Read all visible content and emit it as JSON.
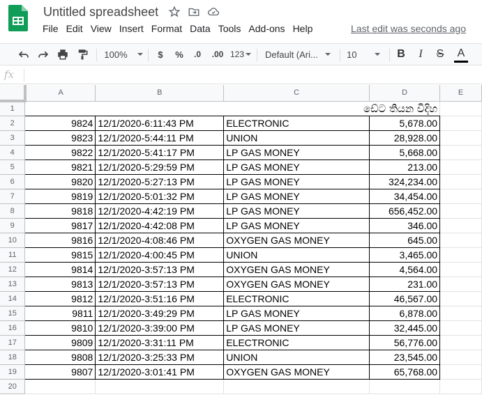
{
  "app": {
    "title": "Untitled spreadsheet",
    "last_edit": "Last edit was seconds ago",
    "brand_color": "#0F9D58"
  },
  "menu": [
    "File",
    "Edit",
    "View",
    "Insert",
    "Format",
    "Data",
    "Tools",
    "Add-ons",
    "Help"
  ],
  "toolbar": {
    "zoom": "100%",
    "currency": "$",
    "percent": "%",
    "decrease_decimal": ".0",
    "increase_decimal": ".00",
    "more_formats": "123",
    "font": "Default (Ari...",
    "font_size": "10",
    "bold": "B",
    "italic": "I",
    "strike": "S",
    "text_color": "A"
  },
  "formula_bar": {
    "fx": "fx",
    "value": ""
  },
  "columns": [
    "A",
    "B",
    "C",
    "D",
    "E"
  ],
  "sheet": {
    "title_cell": "ඩේට තියන විදිහ",
    "rows": [
      {
        "row": "2",
        "a": "9824",
        "b": "12/1/2020-6:11:43 PM",
        "c": "ELECTRONIC",
        "d": "5,678.00"
      },
      {
        "row": "3",
        "a": "9823",
        "b": "12/1/2020-5:44:11 PM",
        "c": "UNION",
        "d": "28,928.00"
      },
      {
        "row": "4",
        "a": "9822",
        "b": "12/1/2020-5:41:17 PM",
        "c": "LP GAS MONEY",
        "d": "5,668.00"
      },
      {
        "row": "5",
        "a": "9821",
        "b": "12/1/2020-5:29:59 PM",
        "c": "LP GAS MONEY",
        "d": "213.00"
      },
      {
        "row": "6",
        "a": "9820",
        "b": "12/1/2020-5:27:13 PM",
        "c": "LP GAS MONEY",
        "d": "324,234.00"
      },
      {
        "row": "7",
        "a": "9819",
        "b": "12/1/2020-5:01:32 PM",
        "c": "LP GAS MONEY",
        "d": "34,454.00"
      },
      {
        "row": "8",
        "a": "9818",
        "b": "12/1/2020-4:42:19 PM",
        "c": "LP GAS MONEY",
        "d": "656,452.00"
      },
      {
        "row": "9",
        "a": "9817",
        "b": "12/1/2020-4:42:08 PM",
        "c": "LP GAS MONEY",
        "d": "346.00"
      },
      {
        "row": "10",
        "a": "9816",
        "b": "12/1/2020-4:08:46 PM",
        "c": "OXYGEN GAS MONEY",
        "d": "645.00"
      },
      {
        "row": "11",
        "a": "9815",
        "b": "12/1/2020-4:00:45 PM",
        "c": "UNION",
        "d": "3,465.00"
      },
      {
        "row": "12",
        "a": "9814",
        "b": "12/1/2020-3:57:13 PM",
        "c": "OXYGEN GAS MONEY",
        "d": "4,564.00"
      },
      {
        "row": "13",
        "a": "9813",
        "b": "12/1/2020-3:57:13 PM",
        "c": "OXYGEN GAS MONEY",
        "d": "231.00"
      },
      {
        "row": "14",
        "a": "9812",
        "b": "12/1/2020-3:51:16 PM",
        "c": "ELECTRONIC",
        "d": "46,567.00"
      },
      {
        "row": "15",
        "a": "9811",
        "b": "12/1/2020-3:49:29 PM",
        "c": "LP GAS MONEY",
        "d": "6,878.00"
      },
      {
        "row": "16",
        "a": "9810",
        "b": "12/1/2020-3:39:00 PM",
        "c": "LP GAS MONEY",
        "d": "32,445.00"
      },
      {
        "row": "17",
        "a": "9809",
        "b": "12/1/2020-3:31:11 PM",
        "c": "ELECTRONIC",
        "d": "56,776.00"
      },
      {
        "row": "18",
        "a": "9808",
        "b": "12/1/2020-3:25:33 PM",
        "c": "UNION",
        "d": "23,545.00"
      },
      {
        "row": "19",
        "a": "9807",
        "b": "12/1/2020-3:01:41 PM",
        "c": "OXYGEN GAS MONEY",
        "d": "65,768.00"
      }
    ],
    "row_numbers": [
      "1",
      "20"
    ]
  }
}
